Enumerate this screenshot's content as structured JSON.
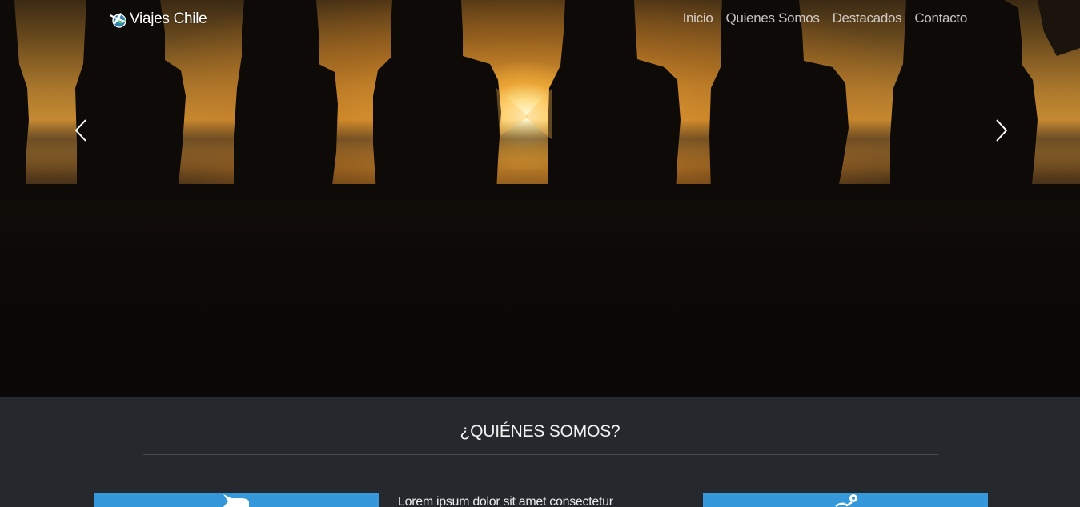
{
  "header": {
    "brand": "Viajes Chile",
    "logo_icon": "globe-plane-icon",
    "nav": [
      {
        "label": "Inicio"
      },
      {
        "label": "Quienes Somos"
      },
      {
        "label": "Destacados"
      },
      {
        "label": "Contacto"
      }
    ]
  },
  "carousel": {
    "prev_icon": "chevron-left-icon",
    "next_icon": "chevron-right-icon"
  },
  "about": {
    "title": "¿QUIÉNES SOMOS?",
    "text": "Lorem ipsum dolor sit amet consectetur",
    "cards": [
      {
        "icon": "airplane-icon",
        "color": "#3498db"
      },
      {
        "icon": "map-pin-route-icon",
        "color": "#3498db"
      }
    ]
  },
  "colors": {
    "section_bg": "#25282c",
    "accent": "#3498db"
  }
}
